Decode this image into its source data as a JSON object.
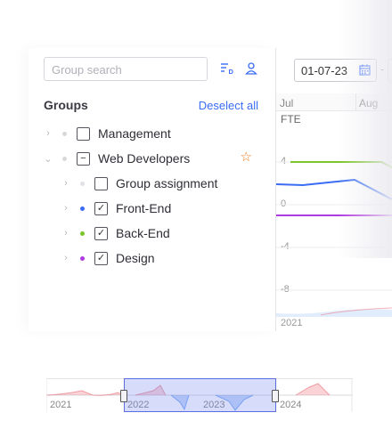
{
  "search": {
    "placeholder": "Group search"
  },
  "panel": {
    "groups_title": "Groups",
    "deselect_label": "Deselect all"
  },
  "tree": {
    "items": [
      {
        "label": "Management",
        "checked": "",
        "dot_color": "#d8d8dc"
      },
      {
        "label": "Web Developers",
        "checked": "−",
        "dot_color": "#d8d8dc"
      },
      {
        "label": "Group assignment",
        "checked": "",
        "dot_color": "#e2e2e6"
      },
      {
        "label": "Front-End",
        "checked": "✓",
        "dot_color": "#3a6cf4"
      },
      {
        "label": "Back-End",
        "checked": "✓",
        "dot_color": "#7ac52a"
      },
      {
        "label": "Design",
        "checked": "✓",
        "dot_color": "#b13ae0"
      }
    ]
  },
  "chart": {
    "start_date": "01-07-23",
    "date_separator": "-",
    "months": [
      "Jul",
      "Aug"
    ],
    "unit": "FTE",
    "ticks": [
      "4",
      "0",
      "-4",
      "-8"
    ],
    "mini_year": "2021",
    "colors": {
      "backend": "#7ac52a",
      "frontend": "#3a6cf4",
      "design": "#b13ae0"
    }
  },
  "navigator": {
    "years": [
      "2021",
      "2022",
      "2023",
      "2024"
    ]
  }
}
